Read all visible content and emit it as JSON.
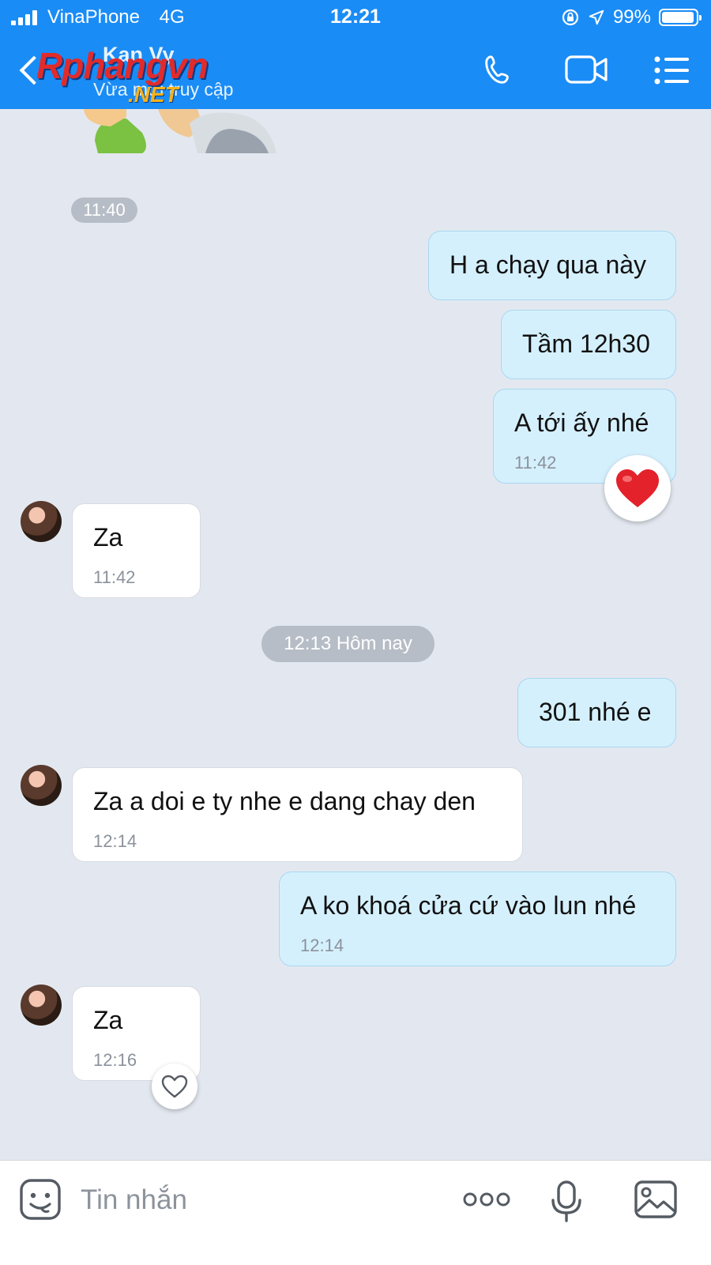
{
  "status_bar": {
    "carrier": "VinaPhone",
    "network": "4G",
    "time": "12:21",
    "battery": "99%",
    "battery_level": 0.99
  },
  "header": {
    "contact_name": "Kan Vy",
    "status": "Vừa mới truy cập",
    "watermark_main": "Rphangvn",
    "watermark_sub": ".NET"
  },
  "icons": {
    "back": "chevron-left-icon",
    "call": "phone-icon",
    "video": "video-camera-icon",
    "menu": "menu-list-icon",
    "emoji": "sticker-icon",
    "more": "more-dots-icon",
    "mic": "microphone-icon",
    "image": "image-icon",
    "reaction_heart": "heart-filled-icon",
    "reaction_like": "heart-outline-icon"
  },
  "colors": {
    "header_bg": "#1a8cf6",
    "chat_bg": "#e3e8f0",
    "mine_bubble": "#d5f0fd",
    "their_bubble": "#ffffff",
    "heart": "#e3222b"
  },
  "chat": {
    "time_separators": [
      "11:40",
      "12:13 Hôm nay"
    ],
    "messages": [
      {
        "sender": "me",
        "text": "H a chạy qua này"
      },
      {
        "sender": "me",
        "text": "Tầm 12h30"
      },
      {
        "sender": "me",
        "text": "A tới ấy nhé",
        "time": "11:42",
        "reaction": "heart"
      },
      {
        "sender": "them",
        "text": "Za",
        "time": "11:42"
      },
      {
        "sender": "me",
        "text": "301 nhé e"
      },
      {
        "sender": "them",
        "text": "Za a doi e ty nhe e dang chay den",
        "time": "12:14"
      },
      {
        "sender": "me",
        "text": "A ko khoá cửa cứ vào lun nhé",
        "time": "12:14"
      },
      {
        "sender": "them",
        "text": "Za",
        "time": "12:16",
        "reaction": "like"
      }
    ]
  },
  "composer": {
    "placeholder": "Tin nhắn"
  }
}
